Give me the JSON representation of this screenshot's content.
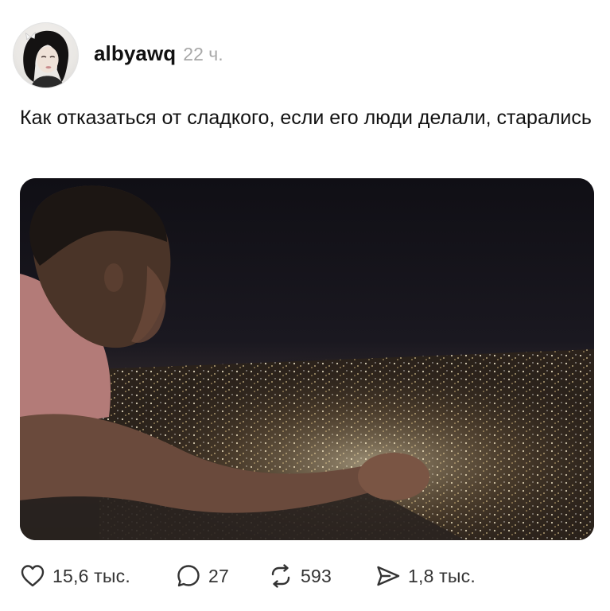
{
  "post": {
    "username": "albyawq",
    "time": "22 ч.",
    "text": "Как отказаться от сладкого, если его люди делали, старались",
    "avatar_icon": "profile-photo",
    "image_alt": "man-looking-over-night-city-photo"
  },
  "actions": {
    "likes": "15,6 тыс.",
    "replies": "27",
    "reposts": "593",
    "shares": "1,8 тыс.",
    "icons": [
      "heart-icon",
      "comment-icon",
      "repost-icon",
      "share-icon"
    ]
  },
  "colors": {
    "text": "#111111",
    "muted": "#a8a8a8",
    "icon": "#333333",
    "image_sky": "#15141a"
  }
}
